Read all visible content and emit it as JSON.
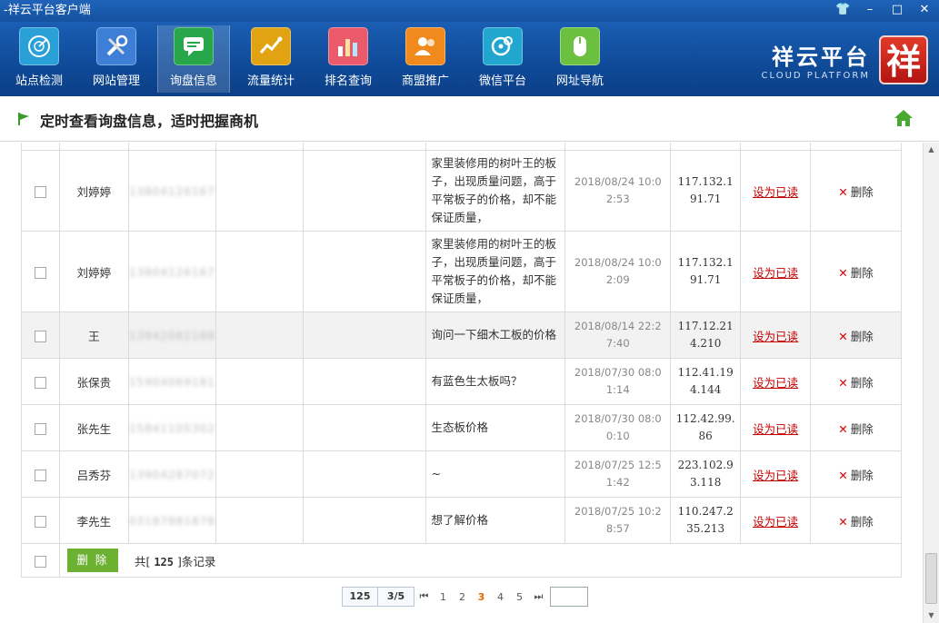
{
  "window": {
    "title": "-祥云平台客户端",
    "buttons": [
      "👕",
      "–",
      "□",
      "✕"
    ]
  },
  "toolbar": {
    "items": [
      {
        "label": "站点检测",
        "color": "#2aa0d8"
      },
      {
        "label": "网站管理",
        "color": "#3d7fd6"
      },
      {
        "label": "询盘信息",
        "color": "#27a74a"
      },
      {
        "label": "流量统计",
        "color": "#e1a312"
      },
      {
        "label": "排名查询",
        "color": "#ea5a6a"
      },
      {
        "label": "商盟推广",
        "color": "#f08a1c"
      },
      {
        "label": "微信平台",
        "color": "#21a7cf"
      },
      {
        "label": "网址导航",
        "color": "#6cc040"
      }
    ],
    "active_index": 2
  },
  "brand": {
    "cn": "祥云平台",
    "en": "CLOUD PLATFORM",
    "seal": "祥"
  },
  "header": {
    "title": "定时查看询盘信息，适时把握商机"
  },
  "rows": [
    {
      "name": "刘婷婷",
      "phone": "13804126167",
      "message": "家里装修用的树叶王的板子，出现质量问题，高于平常板子的价格，却不能保证质量，",
      "time": "2018/08/24 10:02:53",
      "ip": "117.132.191.71",
      "read": "设为已读",
      "delete": "删除"
    },
    {
      "name": "刘婷婷",
      "phone": "13804126167",
      "message": "家里装修用的树叶王的板子，出现质量问题，高于平常板子的价格，却不能保证质量，",
      "time": "2018/08/24 10:02:09",
      "ip": "117.132.191.71",
      "read": "设为已读",
      "delete": "删除"
    },
    {
      "name": "王",
      "phone": "13942082188",
      "message": "询问一下细木工板的价格",
      "time": "2018/08/14 22:27:40",
      "ip": "117.12.214.210",
      "read": "设为已读",
      "delete": "删除"
    },
    {
      "name": "张保贵",
      "phone": "15904069181",
      "message": "有蓝色生太板吗？",
      "time": "2018/07/30 08:01:14",
      "ip": "112.41.194.144",
      "read": "设为已读",
      "delete": "删除"
    },
    {
      "name": "张先生",
      "phone": "15841105302",
      "message": "生态板价格",
      "time": "2018/07/30 08:00:10",
      "ip": "112.42.99.86",
      "read": "设为已读",
      "delete": "删除"
    },
    {
      "name": "吕秀芬",
      "phone": "13904287072",
      "message": "~",
      "time": "2018/07/25 12:51:42",
      "ip": "223.102.93.118",
      "read": "设为已读",
      "delete": "删除"
    },
    {
      "name": "李先生",
      "phone": "03187881878",
      "message": "想了解价格",
      "time": "2018/07/25 10:28:57",
      "ip": "110.247.235.213",
      "read": "设为已读",
      "delete": "删除"
    }
  ],
  "footer": {
    "delete_button": "删 除",
    "total_prefix": "共[",
    "total_count": "125",
    "total_suffix": "]条记录"
  },
  "pager": {
    "total": "125",
    "page_of": "3/5",
    "first": "⏮",
    "last": "⏭",
    "pages": [
      "1",
      "2",
      "3",
      "4",
      "5"
    ],
    "current": "3"
  }
}
